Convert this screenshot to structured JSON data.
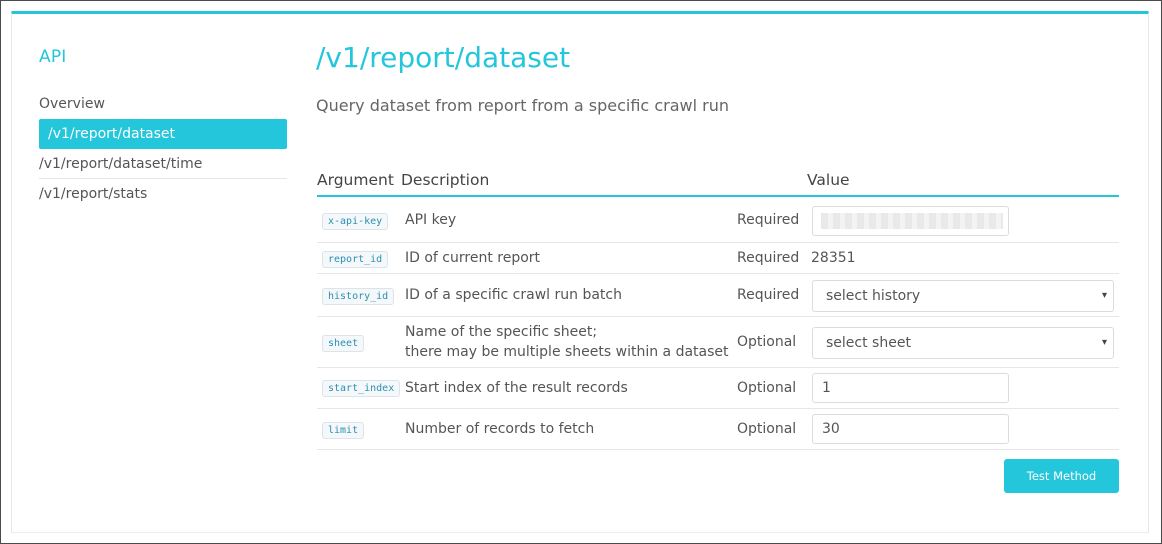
{
  "sidebar": {
    "title": "API",
    "items": [
      {
        "label": "Overview"
      },
      {
        "label": "/v1/report/dataset"
      },
      {
        "label": "/v1/report/dataset/time"
      },
      {
        "label": "/v1/report/stats"
      }
    ],
    "active_index": 1
  },
  "main": {
    "title": "/v1/report/dataset",
    "subtitle": "Query dataset from report from a specific crawl run",
    "table": {
      "headers": {
        "argument": "Argument",
        "description": "Description",
        "value": "Value"
      },
      "rows": [
        {
          "arg": "x-api-key",
          "description": "API key",
          "requirement": "Required",
          "value": "",
          "control": "text-input-masked"
        },
        {
          "arg": "report_id",
          "description": "ID of current report",
          "requirement": "Required",
          "value": "28351",
          "control": "static"
        },
        {
          "arg": "history_id",
          "description": "ID of a specific crawl run batch",
          "requirement": "Required",
          "value": "select history",
          "control": "select"
        },
        {
          "arg": "sheet",
          "description_line1": "Name of the specific sheet;",
          "description_line2": "there may be multiple sheets within a dataset",
          "requirement": "Optional",
          "value": "select sheet",
          "control": "select"
        },
        {
          "arg": "start_index",
          "description": "Start index of the result records",
          "requirement": "Optional",
          "value": "1",
          "control": "text-input"
        },
        {
          "arg": "limit",
          "description": "Number of records to fetch",
          "requirement": "Optional",
          "value": "30",
          "control": "text-input"
        }
      ]
    },
    "test_button_label": "Test Method"
  },
  "icons": {
    "select_caret": "▾"
  },
  "colors": {
    "accent": "#23c6db"
  }
}
